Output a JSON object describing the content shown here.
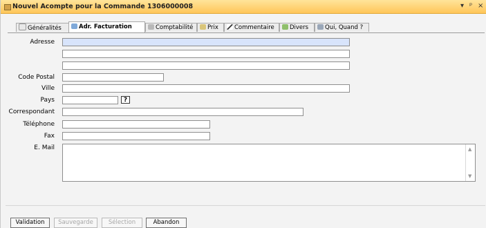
{
  "window": {
    "title": "Nouvel Acompte pour la Commande 1306000008",
    "controls": {
      "dropdown": "▾",
      "pin": "ᵖ",
      "close": "×"
    }
  },
  "tabs": [
    {
      "label": "Généralités",
      "icon": "document-icon",
      "active": false
    },
    {
      "label": "Adr. Facturation",
      "icon": "address-icon",
      "active": true
    },
    {
      "label": "Comptabilité",
      "icon": "ledger-icon",
      "active": false
    },
    {
      "label": "Prix",
      "icon": "price-icon",
      "active": false
    },
    {
      "label": "Commentaire",
      "icon": "pen-icon",
      "active": false
    },
    {
      "label": "Divers",
      "icon": "misc-icon",
      "active": false
    },
    {
      "label": "Qui, Quand ?",
      "icon": "who-when-icon",
      "active": false
    }
  ],
  "form": {
    "adresse_label": "Adresse",
    "adresse_1": "",
    "adresse_2": "",
    "adresse_3": "",
    "code_postal_label": "Code Postal",
    "code_postal": "",
    "ville_label": "Ville",
    "ville": "",
    "pays_label": "Pays",
    "pays": "",
    "pays_help": "?",
    "correspondant_label": "Correspondant",
    "correspondant": "",
    "telephone_label": "Téléphone",
    "telephone": "",
    "fax_label": "Fax",
    "fax": "",
    "email_label": "E. Mail",
    "email": ""
  },
  "buttons": {
    "validation": "Validation",
    "sauvegarde": "Sauvegarde",
    "selection": "Sélection",
    "abandon": "Abandon"
  },
  "colors": {
    "titlebar": "#ffc659",
    "highlight_field": "#d8e4fb"
  }
}
